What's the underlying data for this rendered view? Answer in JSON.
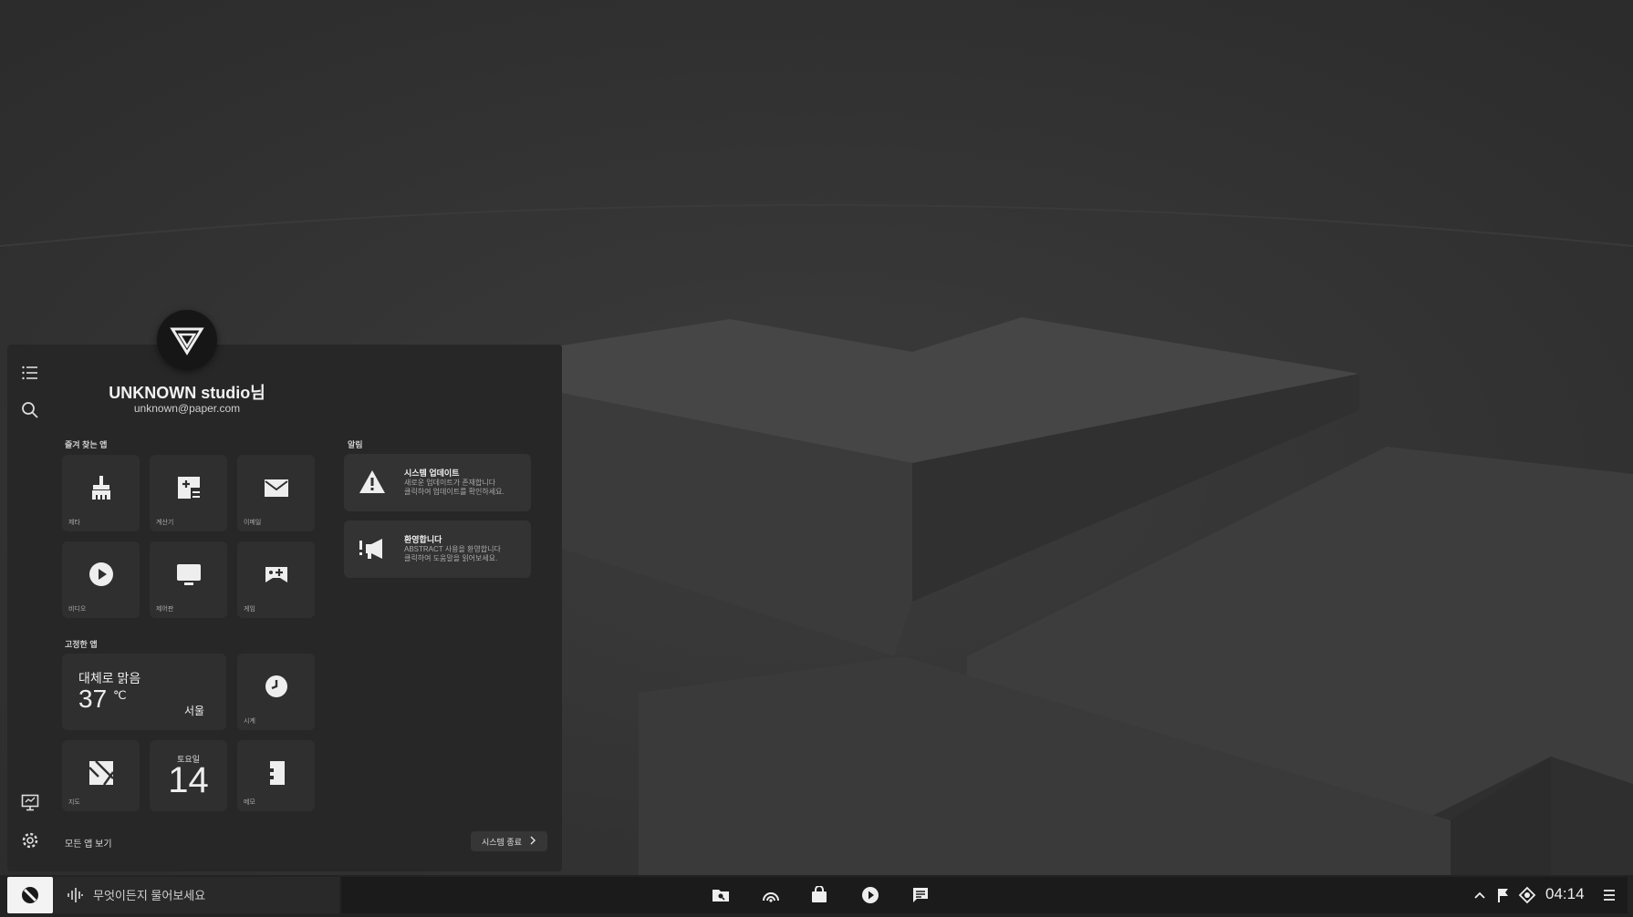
{
  "user": {
    "name": "UNKNOWN studio님",
    "email": "unknown@paper.com"
  },
  "sections": {
    "favorites": "즐겨 찾는 앱",
    "notifications": "알림",
    "pinned": "고정한 앱"
  },
  "favorites": [
    {
      "label": "제타",
      "icon": "cleanup-icon"
    },
    {
      "label": "계산기",
      "icon": "calculator-icon"
    },
    {
      "label": "이메일",
      "icon": "mail-icon"
    },
    {
      "label": "비디오",
      "icon": "play-icon"
    },
    {
      "label": "제어판",
      "icon": "monitor-icon"
    },
    {
      "label": "게임",
      "icon": "game-icon"
    }
  ],
  "notifications": [
    {
      "title": "시스템 업데이트",
      "body1": "새로운 업데이트가 존재합니다",
      "body2": "클릭하여 업데이트를 확인하세요.",
      "icon": "warning-icon"
    },
    {
      "title": "환영합니다",
      "body1": "ABSTRACT 사용을 환영합니다",
      "body2": "클릭하여 도움말을 읽어보세요.",
      "icon": "megaphone-icon"
    }
  ],
  "weather": {
    "condition": "대체로 맑음",
    "temperature": "37",
    "unit": "℃",
    "city": "서울"
  },
  "pinned": {
    "clock_label": "시계",
    "map_label": "지도",
    "notes_label": "메모"
  },
  "calendar": {
    "weekday": "토요일",
    "date": "14"
  },
  "footer": {
    "all_apps": "모든 앱 보기",
    "power": "시스템 종료"
  },
  "taskbar": {
    "search_placeholder": "무엇이든지 물어보세요",
    "icons": [
      "folder-icon",
      "browser-icon",
      "store-icon",
      "media-icon",
      "chat-icon"
    ],
    "tray": [
      "chevron-up-icon",
      "flag-icon",
      "network-icon",
      "menu-icon"
    ],
    "time": "04:14"
  },
  "colors": {
    "panel": "#272727",
    "tile": "#2f2f2f",
    "taskbar": "#1b1b1b",
    "accent": "#f3f3f3"
  }
}
